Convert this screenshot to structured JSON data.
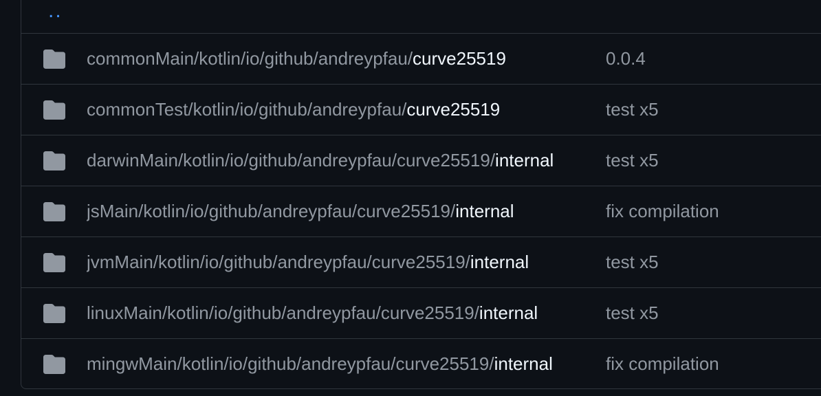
{
  "parent": {
    "label": ".."
  },
  "rows": [
    {
      "prefix": "commonMain/kotlin/io/github/andreypfau/",
      "last": "curve25519",
      "commit": "0.0.4"
    },
    {
      "prefix": "commonTest/kotlin/io/github/andreypfau/",
      "last": "curve25519",
      "commit": "test x5"
    },
    {
      "prefix": "darwinMain/kotlin/io/github/andreypfau/curve25519/",
      "last": "internal",
      "commit": "test x5"
    },
    {
      "prefix": "jsMain/kotlin/io/github/andreypfau/curve25519/",
      "last": "internal",
      "commit": "fix compilation"
    },
    {
      "prefix": "jvmMain/kotlin/io/github/andreypfau/curve25519/",
      "last": "internal",
      "commit": "test x5"
    },
    {
      "prefix": "linuxMain/kotlin/io/github/andreypfau/curve25519/",
      "last": "internal",
      "commit": "test x5"
    },
    {
      "prefix": "mingwMain/kotlin/io/github/andreypfau/curve25519/",
      "last": "internal",
      "commit": "fix compilation"
    }
  ],
  "colors": {
    "background": "#0d1117",
    "border": "#30363d",
    "muted_text": "#9198a1",
    "bright_text": "#f0f6fc",
    "link": "#4493f8",
    "folder_icon": "#9198a1"
  },
  "icons": {
    "row_icon": "folder-icon"
  }
}
